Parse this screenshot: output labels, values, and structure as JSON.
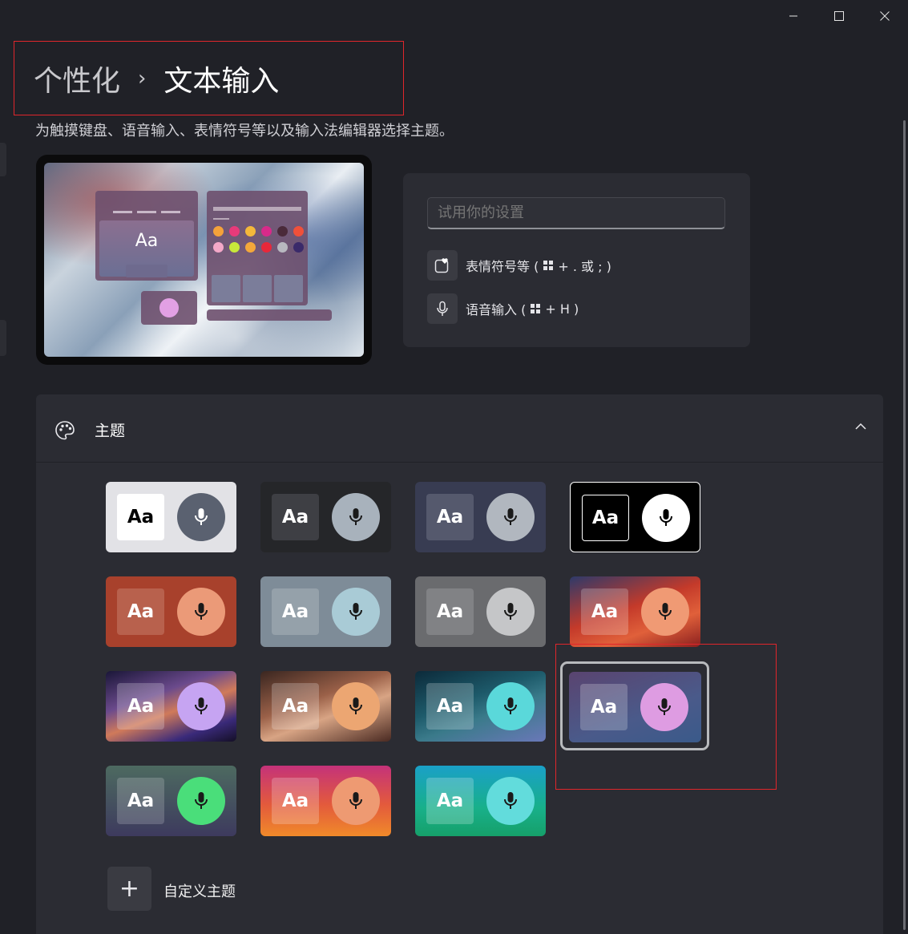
{
  "window": {
    "minimize_glyph": "—",
    "maximize_glyph": "□",
    "close_glyph": "✕"
  },
  "breadcrumb": {
    "parent": "个性化",
    "separator": "›",
    "current": "文本输入"
  },
  "description": "为触摸键盘、语音输入、表情符号等以及输入法编辑器选择主题。",
  "preview": {
    "aa_label": "Aa"
  },
  "try_panel": {
    "input_placeholder": "试用你的设置",
    "emoji_label_pre": "表情符号等 (",
    "emoji_label_post": " + . 或 ; )",
    "voice_label_pre": "语音输入 (",
    "voice_label_post": " + H )"
  },
  "theme_section": {
    "title": "主题",
    "expanded": true
  },
  "themes": [
    {
      "aa": "Aa",
      "bg": "#e2e2e6",
      "aa_bg": "#ffffff",
      "aa_fg": "#000000",
      "mic_bg": "#5a6170",
      "mic_fg": "#ffffff"
    },
    {
      "aa": "Aa",
      "bg": "#252629",
      "aa_bg": "#3e3f44",
      "aa_fg": "#ffffff",
      "mic_bg": "#a8b2bc",
      "mic_fg": "#1a1a1a"
    },
    {
      "aa": "Aa",
      "bg": "#383c52",
      "aa_bg": "#55596d",
      "aa_fg": "#ffffff",
      "mic_bg": "#b1b7bf",
      "mic_fg": "#1a1a1a"
    },
    {
      "aa": "Aa",
      "bg": "#000000",
      "aa_bg": "#000000",
      "aa_fg": "#ffffff",
      "mic_bg": "#ffffff",
      "mic_fg": "#000000",
      "border": "#ffffff"
    },
    {
      "aa": "Aa",
      "bg": "#a8412c",
      "aa_bg": "#b8614d",
      "aa_fg": "#ffffff",
      "mic_bg": "#eb9a78",
      "mic_fg": "#1a1a1a"
    },
    {
      "aa": "Aa",
      "bg": "#7e8c98",
      "aa_bg": "#95a1aa",
      "aa_fg": "#ffffff",
      "mic_bg": "#a9cbd6",
      "mic_fg": "#1a1a1a"
    },
    {
      "aa": "Aa",
      "bg": "#6a6b6e",
      "aa_bg": "#818285",
      "aa_fg": "#ffffff",
      "mic_bg": "#c5c6c8",
      "mic_fg": "#1a1a1a"
    },
    {
      "aa": "Aa",
      "bg": "linear-gradient(160deg,#2e3a6a 0%,#c43a2a 45%,#e0603a 70%,#8a1f1f 100%)",
      "aa_bg": "rgba(255,255,255,0.22)",
      "aa_fg": "#ffffff",
      "mic_bg": "#f09a74",
      "mic_fg": "#1a1a1a"
    },
    {
      "aa": "Aa",
      "bg": "linear-gradient(160deg,#1a1638 0%,#6b4a8c 35%,#d07a5a 55%,#3a2a7a 80%,#140f26 100%)",
      "aa_bg": "rgba(255,255,255,0.22)",
      "aa_fg": "#ffffff",
      "mic_bg": "#c6a4f2",
      "mic_fg": "#1a1a1a"
    },
    {
      "aa": "Aa",
      "bg": "linear-gradient(160deg,#3a2620 0%,#9a6048 40%,#d8a484 60%,#4a2a22 100%)",
      "aa_bg": "rgba(255,255,255,0.22)",
      "aa_fg": "#ffffff",
      "mic_bg": "#eca672",
      "mic_fg": "#1a1a1a"
    },
    {
      "aa": "Aa",
      "bg": "linear-gradient(160deg,#0c2a3a 0%,#1d5a6a 40%,#3a7a8a 60%,#6a78b8 100%)",
      "aa_bg": "rgba(255,255,255,0.22)",
      "aa_fg": "#ffffff",
      "mic_bg": "#5ad8da",
      "mic_fg": "#1a1a1a"
    },
    {
      "aa": "Aa",
      "bg": "linear-gradient(160deg,#5a4470 0%,#4a5a8a 60%,#3a5a8a 100%)",
      "aa_bg": "rgba(255,255,255,0.22)",
      "aa_fg": "#ffffff",
      "mic_bg": "#de9ce2",
      "mic_fg": "#1a1a1a",
      "selected": true
    },
    {
      "aa": "Aa",
      "bg": "linear-gradient(180deg,#4d6a60 0%,#3d3a5e 100%)",
      "aa_bg": "rgba(255,255,255,0.18)",
      "aa_fg": "#ffffff",
      "mic_bg": "#4ade7a",
      "mic_fg": "#1a1a1a"
    },
    {
      "aa": "Aa",
      "bg": "linear-gradient(180deg,#c4327a 0%,#e35a3c 55%,#f08a2a 100%)",
      "aa_bg": "rgba(255,255,255,0.22)",
      "aa_fg": "#ffffff",
      "mic_bg": "#ee9a72",
      "mic_fg": "#1a1a1a"
    },
    {
      "aa": "Aa",
      "bg": "linear-gradient(180deg,#1aa0c8 0%,#18b08a 60%,#16a06a 100%)",
      "aa_bg": "rgba(255,255,255,0.22)",
      "aa_fg": "#ffffff",
      "mic_bg": "#62dcdc",
      "mic_fg": "#1a1a1a"
    }
  ],
  "custom_theme": {
    "icon": "+",
    "label": "自定义主题"
  },
  "colors": {
    "background": "#202127",
    "card": "#2b2c33",
    "annotation": "#e0262b"
  }
}
